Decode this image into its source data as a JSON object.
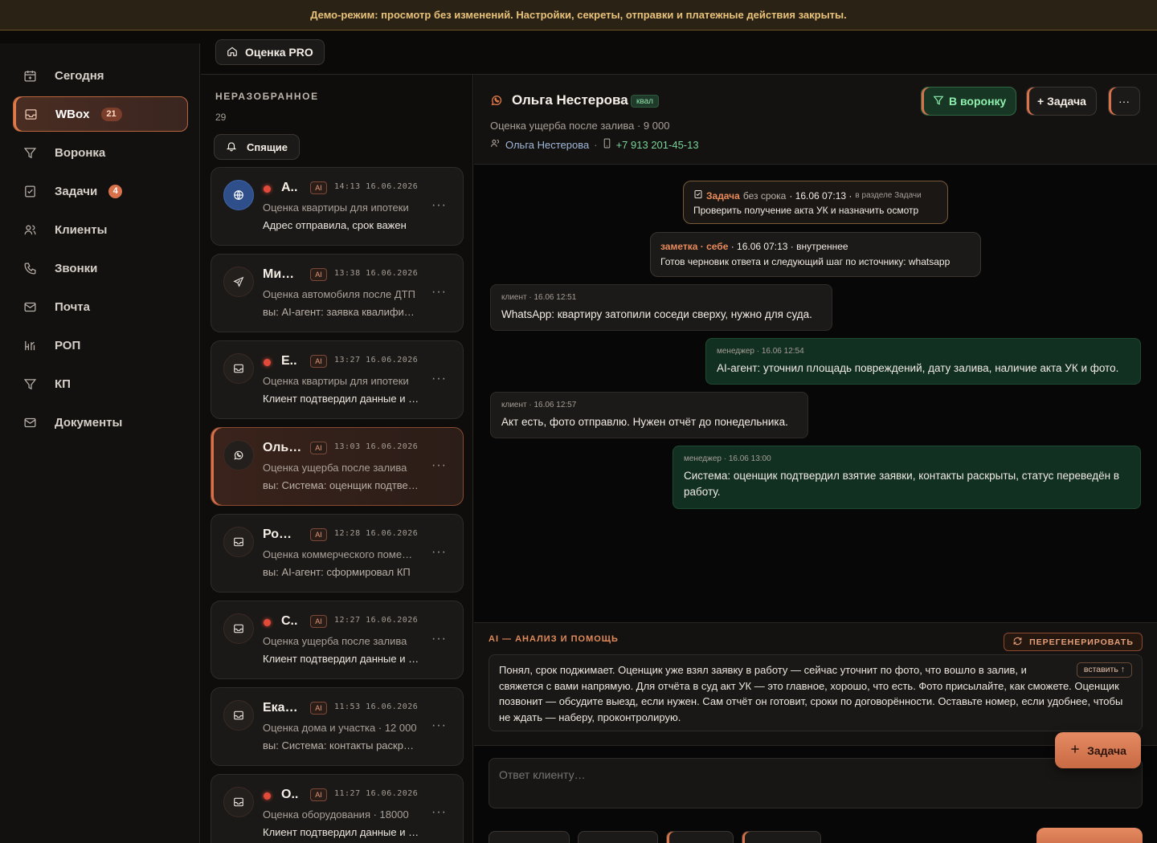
{
  "banner": "Демо-режим: просмотр без изменений. Настройки, секреты, отправки и платежные действия закрыты.",
  "sidebar": {
    "items": [
      {
        "label": "Сегодня",
        "icon": "calendar-icon"
      },
      {
        "label": "WBox",
        "icon": "inbox-icon",
        "badge": "21",
        "active": true
      },
      {
        "label": "Воронка",
        "icon": "filter-icon"
      },
      {
        "label": "Задачи",
        "icon": "checklist-icon",
        "badge": "4"
      },
      {
        "label": "Клиенты",
        "icon": "users-icon"
      },
      {
        "label": "Звонки",
        "icon": "phone-icon"
      },
      {
        "label": "Почта",
        "icon": "mail-icon"
      },
      {
        "label": "РОП",
        "icon": "chart-icon"
      },
      {
        "label": "КП",
        "icon": "filter-icon"
      },
      {
        "label": "Документы",
        "icon": "mail-icon"
      }
    ]
  },
  "topbar": {
    "home_label": "Оценка PRO"
  },
  "list": {
    "title": "НЕРАЗОБРАННОЕ",
    "count": "29",
    "sleeping_label": "Спящие",
    "ai_tag": "AI",
    "cards": [
      {
        "name": "А..",
        "time": "14:13 16.06.2026",
        "line1": "Оценка квартиры для ипотеки",
        "line2": "Адрес отправила, срок важен",
        "unread": true,
        "icon": "globe-icon"
      },
      {
        "name": "Ми…",
        "time": "13:38 16.06.2026",
        "line1": "Оценка автомобиля после ДТП",
        "line2": "вы: AI-агент: заявка квалифицирована",
        "unread": false,
        "icon": "send-icon"
      },
      {
        "name": "Е..",
        "time": "13:27 16.06.2026",
        "line1": "Оценка квартиры для ипотеки",
        "line2": "Клиент подтвердил данные и ждёт",
        "unread": true,
        "icon": "inbox-icon"
      },
      {
        "name": "Оль…",
        "time": "13:03 16.06.2026",
        "line1": "Оценка ущерба после залива",
        "line2": "вы: Система: оценщик подтвердил",
        "unread": false,
        "icon": "whatsapp-icon",
        "active": true
      },
      {
        "name": "Ро…",
        "time": "12:28 16.06.2026",
        "line1": "Оценка коммерческого помещения",
        "line2": "вы: AI-агент: сформировал КП",
        "unread": false,
        "icon": "inbox-icon"
      },
      {
        "name": "С..",
        "time": "12:27 16.06.2026",
        "line1": "Оценка ущерба после залива",
        "line2": "Клиент подтвердил данные и ждёт",
        "unread": true,
        "icon": "inbox-icon"
      },
      {
        "name": "Ека…",
        "time": "11:53 16.06.2026",
        "line1": "Оценка дома и участка · 12 000",
        "line2": "вы: Система: контакты раскрыты",
        "unread": false,
        "icon": "inbox-icon"
      },
      {
        "name": "О..",
        "time": "11:27 16.06.2026",
        "line1": "Оценка оборудования · 18000",
        "line2": "Клиент подтвердил данные и ждёт",
        "unread": true,
        "icon": "inbox-icon"
      }
    ]
  },
  "chat": {
    "name": "Ольга Нестерова",
    "tag": "квал",
    "subtitle": "Оценка ущерба после залива · 9 000",
    "contact_name": "Ольга Нестерова",
    "phone": "+7 913 201-45-13",
    "funnel_label": "В воронку",
    "task_label": "+ Задача",
    "more_label": "···",
    "task_card": {
      "label": "Задача",
      "due": "без срока",
      "time": "· 16.06 07:13 ·",
      "section": "в разделе Задачи",
      "text": "Проверить получение акта УК и назначить осмотр"
    },
    "note": {
      "author": "заметка · себе",
      "time": "· 16.06 07:13 · внутреннее",
      "text": "Готов черновик ответа и следующий шаг по источнику: whatsapp"
    },
    "messages": [
      {
        "role": "client",
        "meta": "клиент · 16.06 12:51",
        "text": "WhatsApp: квартиру затопили соседи сверху, нужно для суда."
      },
      {
        "role": "mgr",
        "meta": "менеджер · 16.06 12:54",
        "text": "AI-агент: уточнил площадь повреждений, дату залива, наличие акта УК и фото."
      },
      {
        "role": "client",
        "meta": "клиент · 16.06 12:57",
        "text": "Акт есть, фото отправлю. Нужен отчёт до понедельника."
      },
      {
        "role": "mgr",
        "meta": "менеджер · 16.06 13:00",
        "text": "Система: оценщик подтвердил взятие заявки, контакты раскрыты, статус переведён в работу."
      }
    ]
  },
  "ai": {
    "title": "AI — АНАЛИЗ И ПОМОЩЬ",
    "regen_label": "ПЕРЕГЕНЕРИРОВАТЬ",
    "insert_label": "вставить ↑",
    "text": "Понял, срок поджимает. Оценщик уже взял заявку в работу — сейчас уточнит по фото, что вошло в залив, и свяжется с вами напрямую. Для отчёта в суд акт УК — это главное, хорошо, что есть. Фото присылайте, как сможете. Оценщик позвонит — обсудите выезд, если нужен. Сам отчёт он готовит, сроки по договорённости. Оставьте номер, если удобнее, чтобы не ждать — наберу, проконтролирую."
  },
  "reply": {
    "placeholder": "Ответ клиенту…"
  },
  "fab": {
    "label": "Задача"
  }
}
